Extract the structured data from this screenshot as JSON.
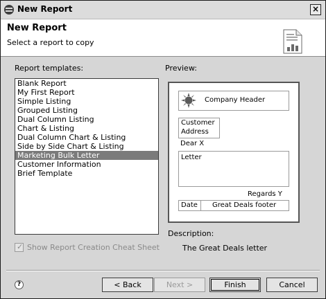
{
  "window": {
    "title": "New Report"
  },
  "header": {
    "title": "New Report",
    "subtitle": "Select a report to copy"
  },
  "templates": {
    "label": "Report templates:",
    "items": [
      "Blank Report",
      "My First Report",
      "Simple Listing",
      "Grouped Listing",
      "Dual Column Listing",
      "Chart & Listing",
      "Dual Column Chart & Listing",
      "Side by Side Chart & Listing",
      "Marketing Bulk Letter",
      "Customer Information",
      "Brief Template"
    ],
    "selected_index": 8
  },
  "preview": {
    "label": "Preview:",
    "company_header": "Company Header",
    "customer_line1": "Customer",
    "customer_line2": "Address",
    "greeting": "Dear X",
    "body": "Letter",
    "closing": "Regards Y",
    "footer_date": "Date",
    "footer_text": "Great Deals footer"
  },
  "description": {
    "label": "Description:",
    "value": "The Great Deals letter"
  },
  "cheat_sheet": {
    "label": "Show Report Creation Cheat Sheet",
    "checked": true,
    "enabled": false
  },
  "buttons": {
    "back": "< Back",
    "next": "Next >",
    "finish": "Finish",
    "cancel": "Cancel"
  },
  "icons": {
    "window": "eclipse-icon",
    "close": "close-icon",
    "header": "report-wizard-icon",
    "logo": "sun-logo-icon",
    "help": "help-icon"
  }
}
